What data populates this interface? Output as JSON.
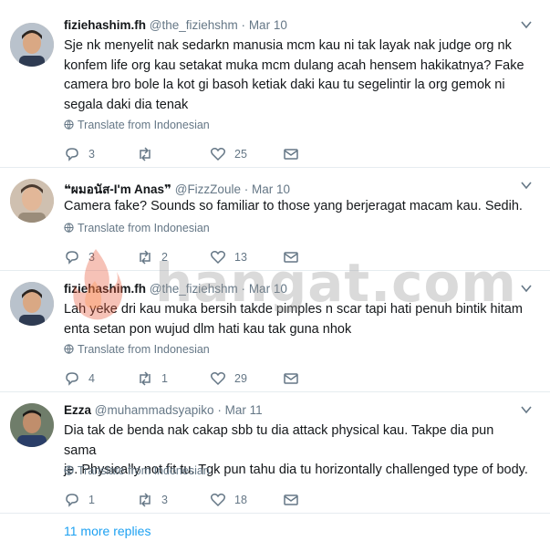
{
  "tweets": [
    {
      "name": "fiziehashim.fh",
      "handle": "@the_fiziehshm",
      "date": "Mar 10",
      "lines": [
        "Sje nk menyelit nak sedarkn manusia mcm kau ni tak layak nak judge org nk",
        "konfem life org kau setakat muka mcm dulang acah hensem hakikatnya? Fake",
        "camera bro bole la kot gi basoh ketiak daki kau tu segelintir la org gemok ni",
        "segala daki dia tenak"
      ],
      "translate": "Translate from Indonesian",
      "replies": "3",
      "retweets": "",
      "likes": "25"
    },
    {
      "name": "❝ผมอนัส-I'm Anas❞",
      "handle": "@FizzZoule",
      "date": "Mar 10",
      "lines": [
        "Camera fake? Sounds so familiar to those yang berjeragat macam kau. Sedih."
      ],
      "translate": "Translate from Indonesian",
      "replies": "3",
      "retweets": "2",
      "likes": "13"
    },
    {
      "name": "fiziehashim.fh",
      "handle": "@the_fiziehshm",
      "date": "Mar 10",
      "lines": [
        "Lah yeke dri kau muka bersih takde pimples n scar tapi hati penuh bintik hitam",
        "enta setan pon wujud dlm hati kau tak guna nhok"
      ],
      "translate": "Translate from Indonesian",
      "replies": "4",
      "retweets": "1",
      "likes": "29"
    },
    {
      "name": "Ezza",
      "handle": "@muhammadsyapiko",
      "date": "Mar 11",
      "lines": [
        "Dia tak de benda nak cakap sbb tu dia attack physical kau. Takpe dia pun sama",
        "je. Physically not fit tu. Tgk pun tahu dia tu horizontally challenged type of body."
      ],
      "translate": "Translate from Indonesian",
      "replies": "1",
      "retweets": "3",
      "likes": "18"
    }
  ],
  "more_replies": "11 more replies",
  "watermark": "hangat.com",
  "colors": {
    "link": "#1da1f2",
    "muted": "#657786",
    "divider": "#e6ecf0"
  }
}
